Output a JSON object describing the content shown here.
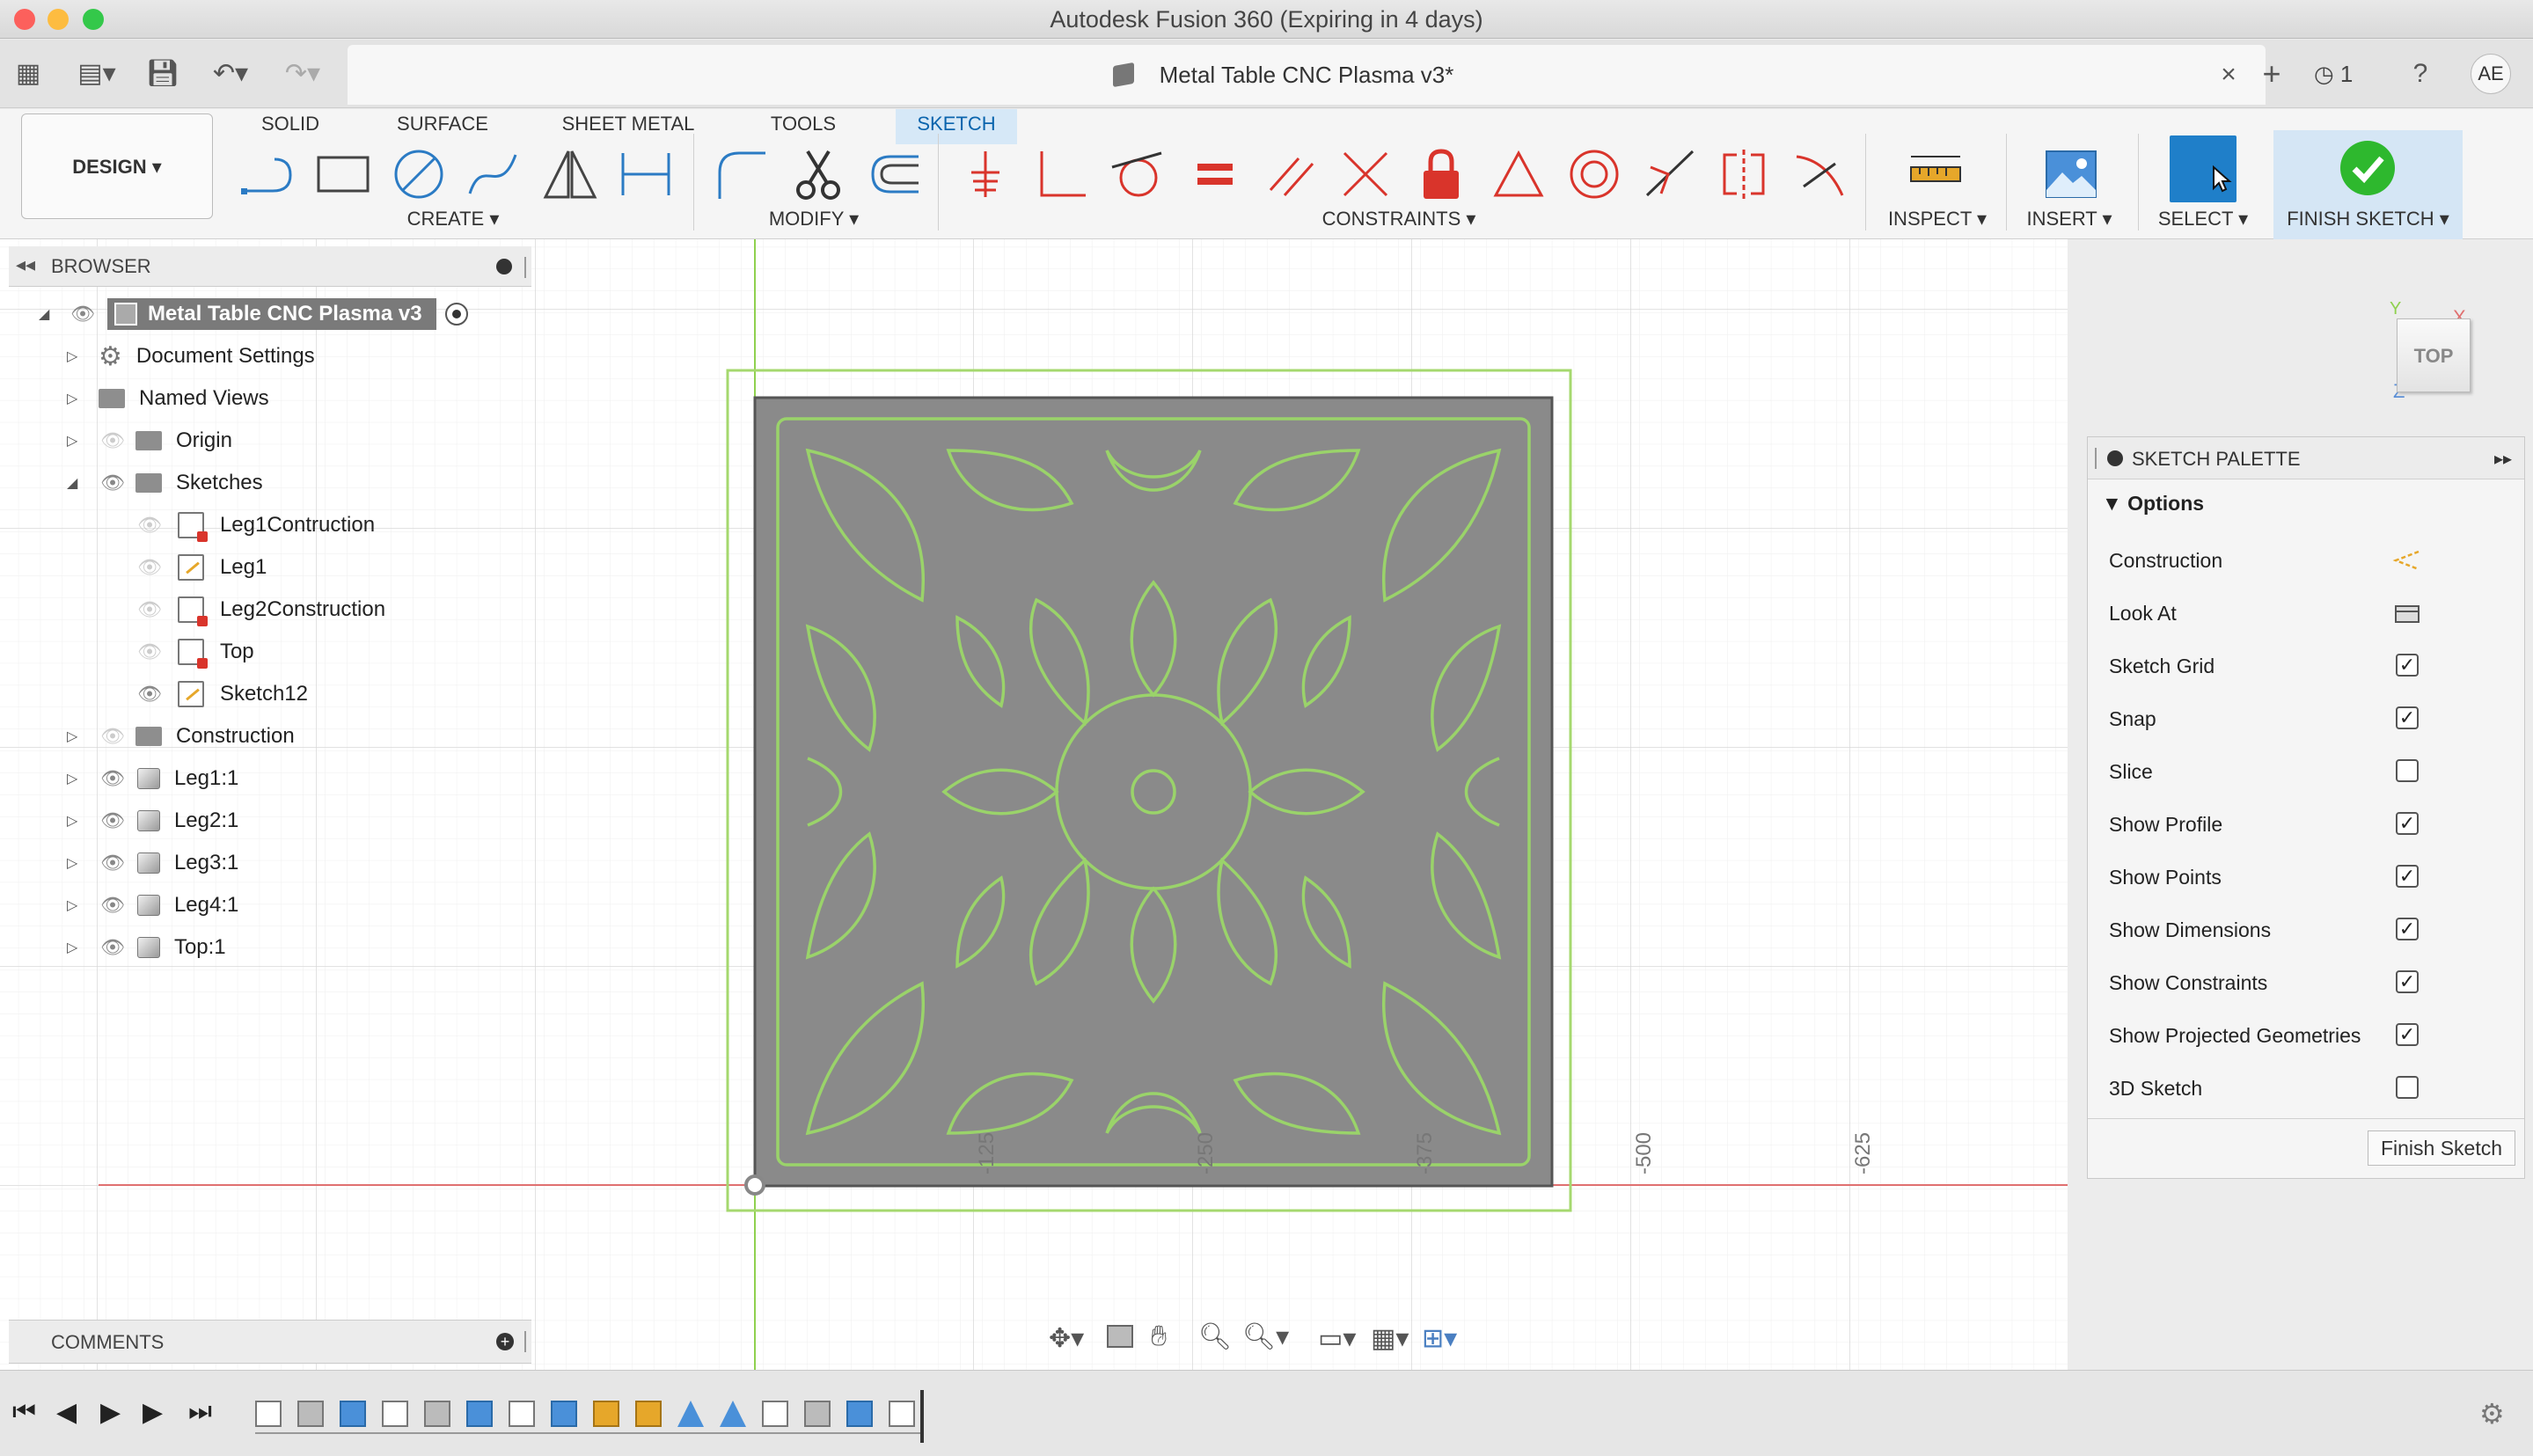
{
  "window": {
    "title": "Autodesk Fusion 360 (Expiring in 4 days)",
    "doc_title": "Metal Table CNC Plasma v3*",
    "notifications": "1",
    "user_initials": "AE"
  },
  "workspace": {
    "label": "DESIGN",
    "tabs": [
      "SOLID",
      "SURFACE",
      "SHEET METAL",
      "TOOLS",
      "SKETCH"
    ],
    "active_tab": "SKETCH"
  },
  "toolbar": {
    "groups": [
      "CREATE",
      "MODIFY",
      "CONSTRAINTS",
      "INSPECT",
      "INSERT",
      "SELECT",
      "FINISH SKETCH"
    ]
  },
  "browser": {
    "title": "BROWSER",
    "root": "Metal Table CNC Plasma v3",
    "items": [
      {
        "label": "Document Settings"
      },
      {
        "label": "Named Views"
      },
      {
        "label": "Origin"
      },
      {
        "label": "Sketches"
      },
      {
        "label": "Leg1Contruction"
      },
      {
        "label": "Leg1"
      },
      {
        "label": "Leg2Construction"
      },
      {
        "label": "Top"
      },
      {
        "label": "Sketch12"
      },
      {
        "label": "Construction"
      },
      {
        "label": "Leg1:1"
      },
      {
        "label": "Leg2:1"
      },
      {
        "label": "Leg3:1"
      },
      {
        "label": "Leg4:1"
      },
      {
        "label": "Top:1"
      }
    ]
  },
  "canvas": {
    "axis_labels": [
      "-125",
      "-250",
      "-375",
      "-500",
      "-625"
    ],
    "viewcube": "TOP",
    "axis_x": "X",
    "axis_z": "Z",
    "axis_y": "Y"
  },
  "palette": {
    "title": "SKETCH PALETTE",
    "section": "Options",
    "options": [
      {
        "label": "Construction",
        "kind": "icon"
      },
      {
        "label": "Look At",
        "kind": "icon"
      },
      {
        "label": "Sketch Grid",
        "checked": true
      },
      {
        "label": "Snap",
        "checked": true
      },
      {
        "label": "Slice",
        "checked": false
      },
      {
        "label": "Show Profile",
        "checked": true
      },
      {
        "label": "Show Points",
        "checked": true
      },
      {
        "label": "Show Dimensions",
        "checked": true
      },
      {
        "label": "Show Constraints",
        "checked": true
      },
      {
        "label": "Show Projected Geometries",
        "checked": true
      },
      {
        "label": "3D Sketch",
        "checked": false
      }
    ],
    "finish_button": "Finish Sketch"
  },
  "comments": {
    "title": "COMMENTS"
  },
  "colors": {
    "accent": "#1f7fc9",
    "sketch_line": "#8fd14f",
    "profile_fill": "#8a8a8a",
    "finish_green": "#2eb82e",
    "x_axis": "#d9534f"
  }
}
